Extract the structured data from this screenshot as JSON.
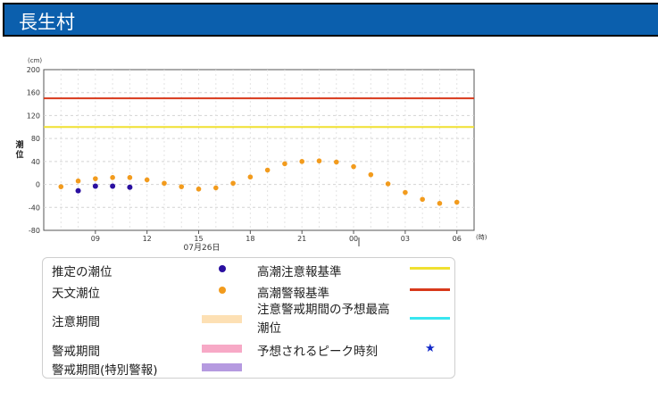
{
  "header": {
    "title": "長生村"
  },
  "chart_data": {
    "type": "scatter",
    "y_unit": "(cm)",
    "ylabel": "潮位",
    "x_unit": "(時)",
    "date_label": "07月26日",
    "ylim": [
      -80,
      200
    ],
    "yticks": [
      -80,
      -40,
      0,
      40,
      80,
      120,
      160,
      200
    ],
    "ytick_labels": [
      "-80",
      "-40",
      "0",
      "40",
      "80",
      "120",
      "160",
      "200"
    ],
    "xlim": [
      6,
      31
    ],
    "xticks": [
      9,
      12,
      15,
      18,
      21,
      24,
      27,
      30
    ],
    "xtick_labels": [
      "09",
      "12",
      "15",
      "18",
      "21",
      "00",
      "03",
      "06"
    ],
    "grid": true,
    "series": [
      {
        "name": "推定の潮位",
        "color": "#2a0fa0",
        "x": [
          8,
          9,
          10,
          11
        ],
        "y": [
          -11,
          -3,
          -3,
          -5
        ]
      },
      {
        "name": "天文潮位",
        "color": "#f29b1d",
        "x": [
          7,
          8,
          9,
          10,
          11,
          12,
          13,
          14,
          15,
          16,
          17,
          18,
          19,
          20,
          21,
          22,
          23,
          24,
          25,
          26,
          27,
          28,
          29,
          30
        ],
        "y": [
          -4,
          6,
          10,
          12,
          12,
          8,
          2,
          -4,
          -8,
          -6,
          2,
          13,
          25,
          36,
          40,
          41,
          39,
          31,
          17,
          1,
          -14,
          -26,
          -33,
          -31
        ]
      }
    ],
    "threshold_lines": [
      {
        "name": "高潮注意報基準",
        "value": 100,
        "color": "#f0e030"
      },
      {
        "name": "高潮警報基準",
        "value": 150,
        "color": "#d8391b"
      }
    ]
  },
  "legend": {
    "items": [
      {
        "label": "推定の潮位",
        "color": "#2a0fa0"
      },
      {
        "label": "天文潮位",
        "color": "#f29b1d"
      },
      {
        "label": "注意期間",
        "color": "#fde0b4"
      },
      {
        "label": "警戒期間",
        "color": "#f7a9c6"
      },
      {
        "label": "警戒期間(特別警報)",
        "color": "#b59ae0"
      },
      {
        "label": "高潮注意報基準",
        "color": "#f0e030"
      },
      {
        "label": "高潮警報基準",
        "color": "#d8391b"
      },
      {
        "label": "注意警戒期間の予想最高潮位",
        "color": "#39e6f0"
      },
      {
        "label": "予想されるピーク時刻",
        "color": "#1228c8",
        "icon": "star-icon"
      }
    ]
  }
}
